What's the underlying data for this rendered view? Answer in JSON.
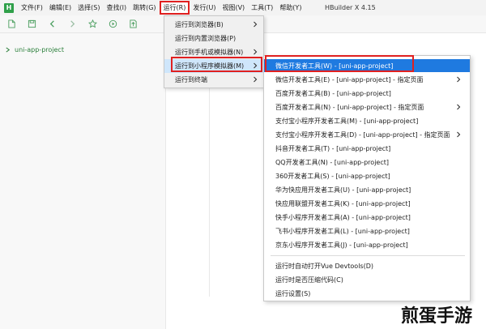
{
  "app": {
    "logo_letter": "H",
    "title": "HBuilder X 4.15"
  },
  "menubar": {
    "items": [
      {
        "label": "文件(F)"
      },
      {
        "label": "编辑(E)"
      },
      {
        "label": "选择(S)"
      },
      {
        "label": "查找(I)"
      },
      {
        "label": "跳转(G)"
      },
      {
        "label": "运行(R)"
      },
      {
        "label": "发行(U)"
      },
      {
        "label": "视图(V)"
      },
      {
        "label": "工具(T)"
      },
      {
        "label": "帮助(Y)"
      }
    ],
    "active": "运行(R)"
  },
  "toolbar": {
    "icons": [
      "new-file-icon",
      "save-icon",
      "back-icon",
      "forward-icon",
      "star-icon",
      "run-icon",
      "publish-icon"
    ]
  },
  "project_tree": {
    "expand_icon": "chevron-right-icon",
    "project_name": "uni-app-project"
  },
  "run_menu": {
    "items": [
      {
        "label": "运行到浏览器(B)",
        "has_submenu": true
      },
      {
        "label": "运行到内置浏览器(P)",
        "has_submenu": false
      },
      {
        "label": "运行到手机或模拟器(N)",
        "has_submenu": true
      },
      {
        "label": "运行到小程序模拟器(M)",
        "has_submenu": true
      },
      {
        "label": "运行到终端",
        "has_submenu": true
      }
    ],
    "highlighted": "运行到小程序模拟器(M)"
  },
  "submenu": {
    "items": [
      {
        "label": "微信开发者工具(W) - [uni-app-project]",
        "has_submenu": false
      },
      {
        "label": "微信开发者工具(E) - [uni-app-project] - 指定页面",
        "has_submenu": true
      },
      {
        "label": "百度开发者工具(B) - [uni-app-project]",
        "has_submenu": false
      },
      {
        "label": "百度开发者工具(N) - [uni-app-project] - 指定页面",
        "has_submenu": true
      },
      {
        "label": "支付宝小程序开发者工具(M) - [uni-app-project]",
        "has_submenu": false
      },
      {
        "label": "支付宝小程序开发者工具(D) - [uni-app-project] - 指定页面",
        "has_submenu": true
      },
      {
        "label": "抖音开发者工具(T) - [uni-app-project]",
        "has_submenu": false
      },
      {
        "label": "QQ开发者工具(N) - [uni-app-project]",
        "has_submenu": false
      },
      {
        "label": "360开发者工具(S) - [uni-app-project]",
        "has_submenu": false
      },
      {
        "label": "华为快应用开发者工具(U) - [uni-app-project]",
        "has_submenu": false
      },
      {
        "label": "快应用联盟开发者工具(K) - [uni-app-project]",
        "has_submenu": false
      },
      {
        "label": "快手小程序开发者工具(A) - [uni-app-project]",
        "has_submenu": false
      },
      {
        "label": "飞书小程序开发者工具(L) - [uni-app-project]",
        "has_submenu": false
      },
      {
        "label": "京东小程序开发者工具(J) - [uni-app-project]",
        "has_submenu": false
      }
    ],
    "options": [
      {
        "label": "运行时自动打开Vue Devtools(D)"
      },
      {
        "label": "运行时是否压缩代码(C)"
      },
      {
        "label": "运行设置(S)"
      }
    ],
    "highlighted": "微信开发者工具(W) - [uni-app-project]"
  },
  "colors": {
    "accent_red": "#e02020",
    "highlight_blue": "#1f7ae0",
    "brand_green": "#2fa04a",
    "menu_hover": "#cfe6fb"
  },
  "watermark": {
    "text": "煎蛋手游"
  }
}
